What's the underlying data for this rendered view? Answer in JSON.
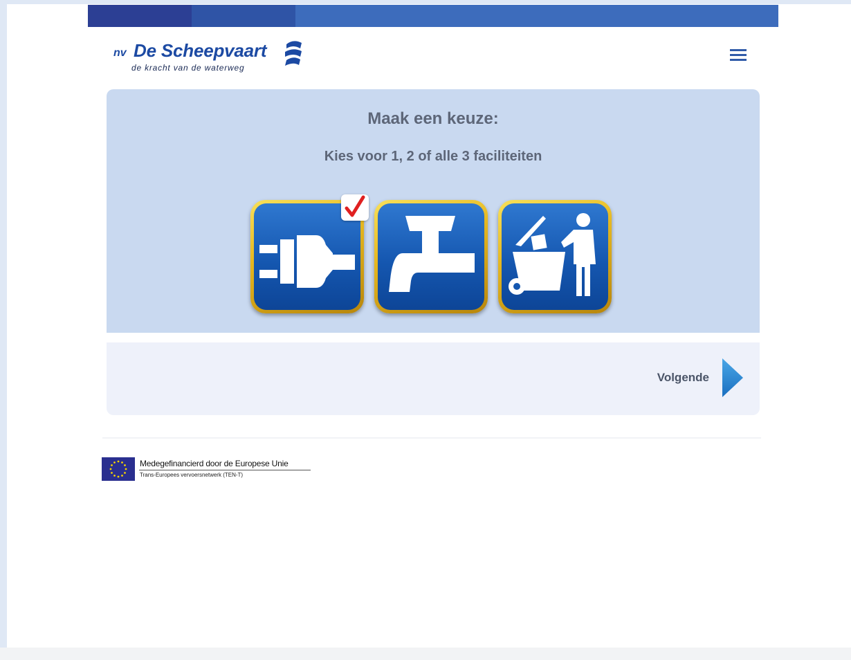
{
  "header": {
    "logo_prefix": "nv",
    "logo_brand": "De Scheepvaart",
    "logo_tagline": "de kracht van de waterweg",
    "menu_icon": "hamburger-menu-icon"
  },
  "main": {
    "title": "Maak een keuze:",
    "subtitle": "Kies voor 1, 2 of alle 3 faciliteiten",
    "facilities": [
      {
        "icon": "power-plug-icon",
        "selected": true
      },
      {
        "icon": "water-tap-icon",
        "selected": false
      },
      {
        "icon": "waste-bin-icon",
        "selected": false
      }
    ]
  },
  "navigation": {
    "next_label": "Volgende",
    "next_icon": "play-arrow-icon"
  },
  "footer": {
    "eu_title": "Medegefinancierd door de Europese Unie",
    "eu_subtitle": "Trans-Europees vervoersnetwerk (TEN-T)",
    "eu_flag_icon": "eu-flag-icon"
  },
  "colors": {
    "accent_blue": "#1c4aa3",
    "panel_bg": "#c9d9f0",
    "tile_gold": "#e6b820",
    "check_red": "#e02020"
  }
}
